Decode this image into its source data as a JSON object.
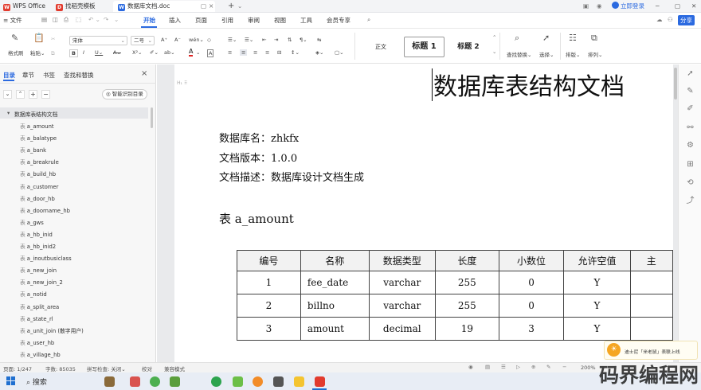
{
  "titlebar": {
    "tabs": [
      {
        "label": "WPS Office",
        "icon": "wps-icon"
      },
      {
        "label": "找稻壳模板",
        "icon": "docer-icon"
      },
      {
        "label": "数据库文档.doc",
        "icon": "word-doc-icon"
      }
    ],
    "login": "立即登录"
  },
  "menubar": {
    "file": "文件",
    "items": [
      "开始",
      "插入",
      "页面",
      "引用",
      "审阅",
      "视图",
      "工具",
      "会员专享"
    ],
    "active": "开始",
    "share": "分享"
  },
  "ribbon": {
    "format_painter": "格式刷",
    "paste": "粘贴",
    "font_name": "宋体",
    "font_size": "二号",
    "styles": [
      "正文",
      "标题 1",
      "标题 2"
    ],
    "find_replace": "查找替换",
    "select": "选择",
    "layout": "排版",
    "arrange": "排列"
  },
  "sidepanel": {
    "tabs": [
      "目录",
      "章节",
      "书签",
      "查找和替换"
    ],
    "active_tab": "目录",
    "smart_toc": "智能识别目录",
    "root": "数据库表结构文档",
    "items": [
      "a_amount",
      "a_balatype",
      "a_bank",
      "a_breakrule",
      "a_build_hb",
      "a_customer",
      "a_door_hb",
      "a_doorname_hb",
      "a_gws",
      "a_hb_inid",
      "a_hb_inid2",
      "a_inoutbusiclass",
      "a_new_join",
      "a_new_join_2",
      "a_notid",
      "a_split_area",
      "a_state_rl",
      "a_unit_join (散字用户)",
      "a_user_hb",
      "a_village_hb"
    ],
    "item_prefix": "表"
  },
  "document": {
    "title": "数据库表结构文档",
    "db_name_label": "数据库名：",
    "db_name": "zhkfx",
    "version_label": "文档版本：",
    "version": "1.0.0",
    "desc_label": "文档描述：",
    "desc": "数据库设计文档生成",
    "table_heading": "表 a_amount",
    "table_headers": [
      "编号",
      "名称",
      "数据类型",
      "长度",
      "小数位",
      "允许空值",
      "主"
    ],
    "table_rows": [
      [
        "1",
        "fee_date",
        "varchar",
        "255",
        "0",
        "Y"
      ],
      [
        "2",
        "billno",
        "varchar",
        "255",
        "0",
        "Y"
      ],
      [
        "3",
        "amount",
        "decimal",
        "19",
        "3",
        "Y"
      ]
    ]
  },
  "statusbar": {
    "page": "页面: 1/247",
    "words": "字数: 85035",
    "spell": "拼写检查: 关闭",
    "proof": "校对",
    "compat": "兼容模式",
    "zoom": "200%"
  },
  "notification": "迪士尼「米老鼠」表联上线",
  "taskbar": {
    "search": "搜索"
  },
  "watermark": "码界编程网"
}
